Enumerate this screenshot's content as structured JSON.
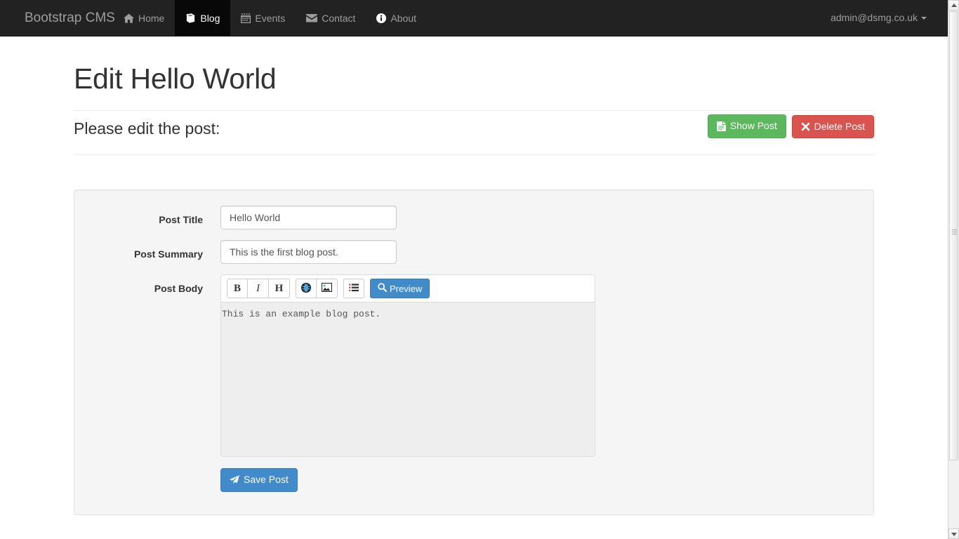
{
  "navbar": {
    "brand": "Bootstrap CMS",
    "links": [
      {
        "label": "Home",
        "icon": "home-icon",
        "active": false
      },
      {
        "label": "Blog",
        "icon": "book-icon",
        "active": true
      },
      {
        "label": "Events",
        "icon": "calendar-icon",
        "active": false
      },
      {
        "label": "Contact",
        "icon": "envelope-icon",
        "active": false
      },
      {
        "label": "About",
        "icon": "info-icon",
        "active": false
      }
    ],
    "user": "admin@dsmg.co.uk",
    "user_caret_icon": "caret-down-icon"
  },
  "page": {
    "title": "Edit Hello World",
    "subhead": "Please edit the post:"
  },
  "actions": {
    "show_post": {
      "label": "Show Post",
      "icon": "file-text-icon",
      "color": "#5cb85c"
    },
    "delete_post": {
      "label": "Delete Post",
      "icon": "remove-x-icon",
      "color": "#d9534f"
    }
  },
  "form": {
    "title_field": {
      "label": "Post Title",
      "value": "Hello World",
      "placeholder": "Post Title"
    },
    "summary_field": {
      "label": "Post Summary",
      "value": "This is the first blog post.",
      "placeholder": "Post Summary"
    },
    "body_field": {
      "label": "Post Body",
      "value": "This is an example blog post.",
      "placeholder": "Post Body"
    },
    "save_button": {
      "label": "Save Post",
      "icon": "paper-plane-icon",
      "color": "#428bca"
    }
  },
  "editor": {
    "toolbar": [
      {
        "name": "bold-button",
        "glyph": "B",
        "title": "Bold"
      },
      {
        "name": "italic-button",
        "glyph": "I",
        "title": "Italic"
      },
      {
        "name": "heading-button",
        "glyph": "H",
        "title": "Heading"
      },
      {
        "name": "link-button",
        "glyph": "globe-icon",
        "title": "URL/Link"
      },
      {
        "name": "image-button",
        "glyph": "picture-icon",
        "title": "Image"
      },
      {
        "name": "list-button",
        "glyph": "list-icon",
        "title": "Unordered List"
      }
    ],
    "preview": {
      "label": "Preview",
      "icon": "search-icon",
      "color": "#428bca"
    }
  },
  "scrollbar": {
    "up_icon": "scroll-up-arrow-icon",
    "down_icon": "scroll-down-arrow-icon"
  }
}
